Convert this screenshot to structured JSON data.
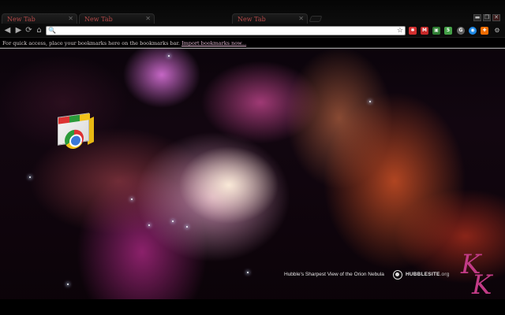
{
  "tabs": [
    {
      "label": "New Tab",
      "active": true
    },
    {
      "label": "New Tab",
      "active": false
    },
    {
      "label": "New Tab",
      "active": false
    }
  ],
  "window_controls": {
    "minimize": "▬",
    "restore": "❐",
    "close": "✕"
  },
  "toolbar": {
    "back": "◀",
    "forward": "▶",
    "reload": "⟳",
    "home": "⌂",
    "omnibox_value": "",
    "bookmark_star": "☆"
  },
  "extensions": [
    {
      "name": "ext-red-icon",
      "color": "#d32f2f",
      "glyph": "✱"
    },
    {
      "name": "ext-gmail-icon",
      "color": "#c62828",
      "glyph": "M"
    },
    {
      "name": "ext-image-icon",
      "color": "#2e7d32",
      "glyph": "▣"
    },
    {
      "name": "ext-feed-icon",
      "color": "#43a047",
      "glyph": "5"
    },
    {
      "name": "ext-google-icon",
      "color": "#616161",
      "glyph": "G"
    },
    {
      "name": "ext-globe-icon",
      "color": "#1e88e5",
      "glyph": "◉"
    },
    {
      "name": "ext-orange-icon",
      "color": "#ef6c00",
      "glyph": "✚"
    },
    {
      "name": "wrench-icon",
      "color": "#0b0b0b",
      "glyph": "🔧"
    }
  ],
  "bookmark_bar": {
    "message": "For quick access, place your bookmarks here on the bookmarks bar.",
    "import_link": "Import bookmarks now..."
  },
  "credit": {
    "caption": "Hubble's Sharpest View of the Orion Nebula",
    "site_name": "HUBBLESITE",
    "site_suffix": ".org"
  },
  "colors": {
    "tab_text": "#b84a4a",
    "monogram": "#c23b86"
  }
}
